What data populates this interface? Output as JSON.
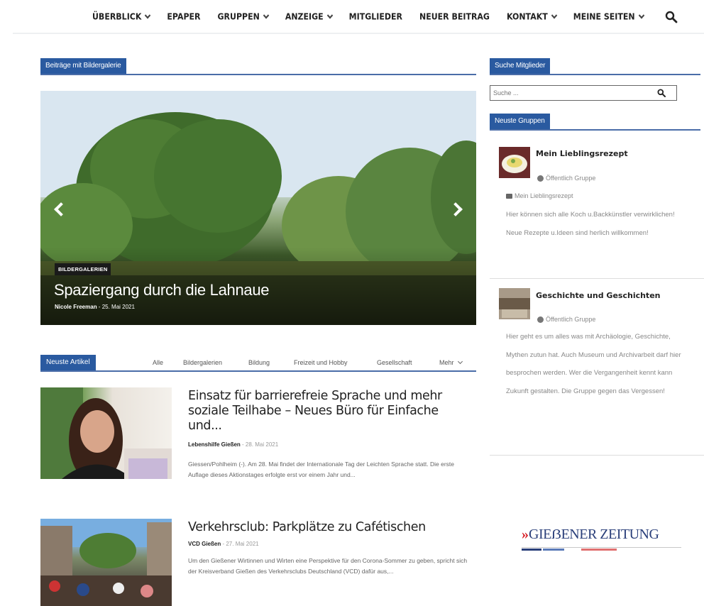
{
  "nav": {
    "items": [
      {
        "label": "ÜBERBLICK",
        "dropdown": true
      },
      {
        "label": "EPAPER",
        "dropdown": false
      },
      {
        "label": "GRUPPEN",
        "dropdown": true
      },
      {
        "label": "ANZEIGE",
        "dropdown": true
      },
      {
        "label": "MITGLIEDER",
        "dropdown": false
      },
      {
        "label": "NEUER BEITRAG",
        "dropdown": false
      },
      {
        "label": "KONTAKT",
        "dropdown": true
      },
      {
        "label": "MEINE SEITEN",
        "dropdown": true
      }
    ],
    "search_icon": "search-icon"
  },
  "gallery": {
    "section_title": "Beiträge mit Bildergalerie",
    "slide": {
      "category": "BILDERGALERIEN",
      "title": "Spaziergang durch die Lahnaue",
      "author": "Nicole Freeman",
      "date": "25. Mai 2021"
    }
  },
  "articles": {
    "section_title": "Neuste Artikel",
    "tabs": [
      "Alle",
      "Bildergalerien",
      "Bildung",
      "Freizeit und Hobby",
      "Gesellschaft",
      "Mehr"
    ],
    "items": [
      {
        "title": "Einsatz für barrierefreie Sprache und mehr soziale Teilhabe – Neues Büro für Einfache und...",
        "author": "Lebenshilfe Gießen",
        "date": "28. Mai 2021",
        "excerpt": "Giessen/Pohlheim (-). Am 28. Mai findet der Internationale Tag der Leichten Sprache statt. Die erste Auflage dieses Aktionstages erfolgte erst vor einem Jahr und..."
      },
      {
        "title": "Verkehrsclub: Parkplätze zu Cafétischen",
        "author": "VCD Gießen",
        "date": "27. Mai 2021",
        "excerpt": "Um den Gießener Wirtinnen und Wirten eine Perspektive für den Corona-Sommer zu geben, spricht sich der Kreisverband Gießen des Verkehrsclubs Deutschland (VCD) dafür aus,..."
      }
    ]
  },
  "sidebar": {
    "members_title": "Suche Mitglieder",
    "search_placeholder": "Suche ...",
    "groups_title": "Neuste Gruppen",
    "groups": [
      {
        "name": "Mein Lieblingsrezept",
        "visibility": "Öffentlich Gruppe",
        "folder": "Mein Lieblingsrezept",
        "description": "Hier können sich alle Koch u.Backkünstler verwirklichen! Neue Rezepte u.Ideen sind herlich willkommen!"
      },
      {
        "name": "Geschichte und Geschichten",
        "visibility": "Öffentlich Gruppe",
        "description": "Hier geht es um alles was mit Archäologie, Geschichte, Mythen zutun hat. Auch Museum und Archivarbeit darf hier besprochen werden. Wer die Vergangenheit kennt kann Zukunft gestalten. Die Gruppe gegen das Vergessen!"
      }
    ],
    "logo": {
      "mark": "»",
      "text": "GIEẞENER ZEITUNG"
    }
  },
  "colors": {
    "accent": "#2a5aa0",
    "logo_red": "#d9242b",
    "logo_blue": "#2a3f7a"
  }
}
